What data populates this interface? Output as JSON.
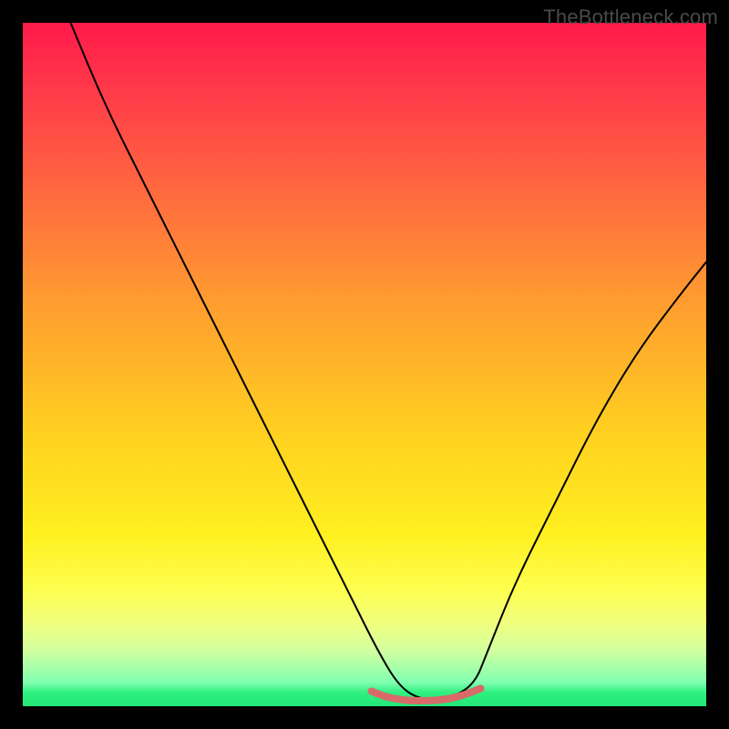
{
  "watermark": "TheBottleneck.com",
  "chart_data": {
    "type": "line",
    "title": "",
    "xlabel": "",
    "ylabel": "",
    "xlim": [
      0,
      100
    ],
    "ylim": [
      0,
      100
    ],
    "grid": false,
    "legend": false,
    "background": {
      "style": "vertical-gradient",
      "stops": [
        {
          "pos": 0,
          "color": "#ff1a4a"
        },
        {
          "pos": 50,
          "color": "#ffb020"
        },
        {
          "pos": 80,
          "color": "#fff030"
        },
        {
          "pos": 95,
          "color": "#a0ff90"
        },
        {
          "pos": 100,
          "color": "#20e878"
        }
      ]
    },
    "series": [
      {
        "name": "bottleneck-curve",
        "color": "#000000",
        "stroke_width": 2,
        "x": [
          7,
          12,
          18,
          24,
          30,
          36,
          42,
          48,
          52,
          55,
          58,
          62,
          66,
          68,
          72,
          78,
          84,
          90,
          96,
          100
        ],
        "values": [
          100,
          88,
          76,
          64,
          52,
          40,
          28,
          16,
          8,
          3,
          1,
          1,
          3,
          8,
          18,
          30,
          42,
          52,
          60,
          65
        ]
      },
      {
        "name": "minimum-band",
        "color": "#d86a6a",
        "stroke_width": 8,
        "x": [
          51,
          53,
          55,
          57,
          59,
          61,
          63,
          65,
          67
        ],
        "values": [
          2.2,
          1.4,
          1.0,
          0.8,
          0.8,
          0.9,
          1.2,
          1.8,
          2.6
        ]
      }
    ],
    "annotations": []
  }
}
